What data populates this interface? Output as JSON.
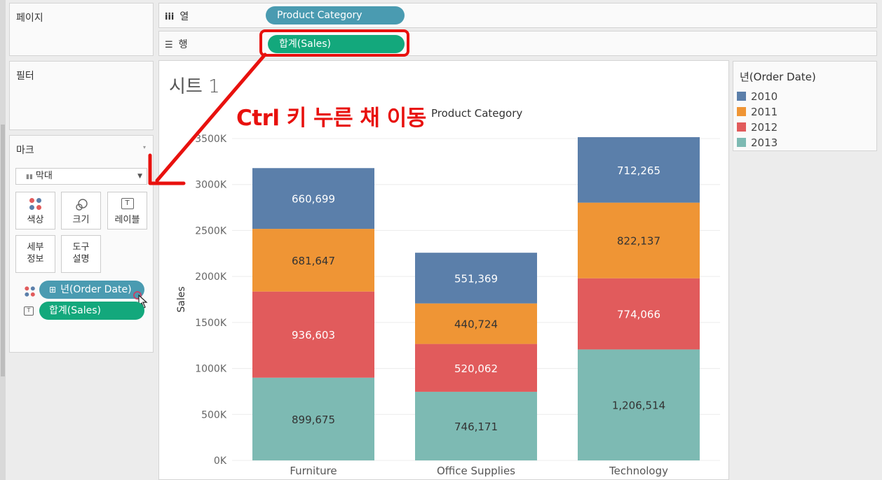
{
  "pages_card": {
    "title": "페이지"
  },
  "filters_card": {
    "title": "필터"
  },
  "marks_card": {
    "title": "마크",
    "mark_type": "막대",
    "buttons": {
      "color": "색상",
      "size": "크기",
      "label": "레이블",
      "detail_1": "세부",
      "detail_2": "정보",
      "tooltip_1": "도구",
      "tooltip_2": "설명"
    },
    "fields": [
      {
        "text": "년(Order Date)",
        "prefix": "⊞"
      },
      {
        "text": "합계(Sales)"
      }
    ]
  },
  "columns_shelf": {
    "label": "열",
    "pill": "Product Category"
  },
  "rows_shelf": {
    "label": "행",
    "pill": "합계(Sales)"
  },
  "sheet": {
    "title": "시트 1",
    "annotation": "Ctrl 키 누른 채 이동",
    "column_header": "Product Category"
  },
  "legend": {
    "title": "년(Order Date)",
    "items": [
      {
        "label": "2010",
        "color": "#5b7faa"
      },
      {
        "label": "2011",
        "color": "#ef9535"
      },
      {
        "label": "2012",
        "color": "#e15b5c"
      },
      {
        "label": "2013",
        "color": "#7dbab3"
      }
    ]
  },
  "colors": {
    "accent_red": "#e8110e",
    "pill_blue": "#4a9bb1",
    "pill_green": "#13a87c"
  },
  "chart_data": {
    "type": "bar",
    "stacked": true,
    "categories": [
      "Furniture",
      "Office Supplies",
      "Technology"
    ],
    "series": [
      {
        "name": "2013",
        "values": [
          899675,
          746171,
          1206514
        ],
        "labels": [
          "899,675",
          "746,171",
          "1,206,514"
        ],
        "color": "#7dbab3",
        "label_color": "#333333"
      },
      {
        "name": "2012",
        "values": [
          936603,
          520062,
          774066
        ],
        "labels": [
          "936,603",
          "520,062",
          "774,066"
        ],
        "color": "#e15b5c",
        "label_color": "#ffffff"
      },
      {
        "name": "2011",
        "values": [
          681647,
          440724,
          822137
        ],
        "labels": [
          "681,647",
          "440,724",
          "822,137"
        ],
        "color": "#ef9535",
        "label_color": "#333333"
      },
      {
        "name": "2010",
        "values": [
          660699,
          551369,
          712265
        ],
        "labels": [
          "660,699",
          "551,369",
          "712,265"
        ],
        "color": "#5b7faa",
        "label_color": "#ffffff"
      }
    ],
    "ylabel": "Sales",
    "ylim": [
      0,
      3500000
    ],
    "yticks": [
      0,
      500000,
      1000000,
      1500000,
      2000000,
      2500000,
      3000000,
      3500000
    ],
    "ytick_labels": [
      "0K",
      "500K",
      "1000K",
      "1500K",
      "2000K",
      "2500K",
      "3000K",
      "3500K"
    ],
    "grid": true
  }
}
